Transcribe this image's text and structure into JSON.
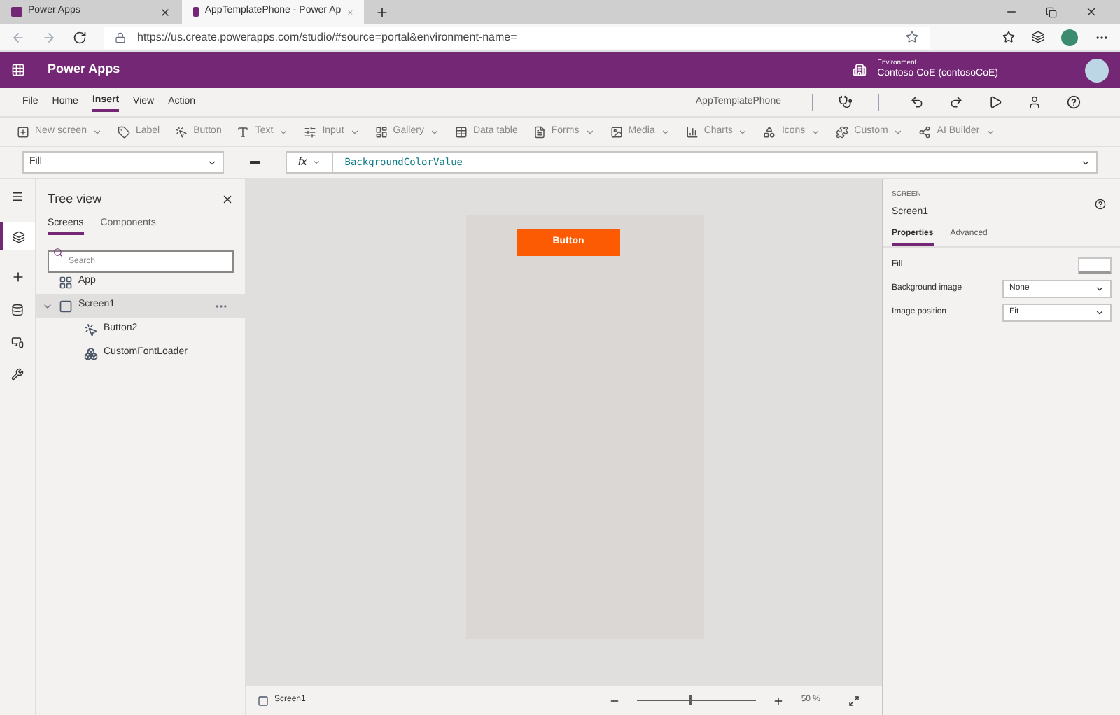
{
  "browser": {
    "tabs": [
      {
        "title": "Power Apps",
        "selected": false
      },
      {
        "title": "AppTemplatePhone - Power Ap",
        "selected": true
      }
    ],
    "url": "https://us.create.powerapps.com/studio/#source=portal&environment-name="
  },
  "header": {
    "title": "Power Apps",
    "environment_label": "Environment",
    "environment_name": "Contoso CoE (contosoCoE)"
  },
  "menu": [
    {
      "label": "File",
      "selected": false
    },
    {
      "label": "Home",
      "selected": false
    },
    {
      "label": "Insert",
      "selected": true
    },
    {
      "label": "View",
      "selected": false
    },
    {
      "label": "Action",
      "selected": false
    }
  ],
  "app_name": "AppTemplatePhone",
  "ribbon": [
    {
      "label": "New screen",
      "dropdown": true
    },
    {
      "label": "Label",
      "dropdown": false
    },
    {
      "label": "Button",
      "dropdown": false
    },
    {
      "label": "Text",
      "dropdown": true
    },
    {
      "label": "Input",
      "dropdown": true
    },
    {
      "label": "Gallery",
      "dropdown": true
    },
    {
      "label": "Data table",
      "dropdown": false
    },
    {
      "label": "Forms",
      "dropdown": true
    },
    {
      "label": "Media",
      "dropdown": true
    },
    {
      "label": "Charts",
      "dropdown": true
    },
    {
      "label": "Icons",
      "dropdown": true
    },
    {
      "label": "Custom",
      "dropdown": true
    },
    {
      "label": "AI Builder",
      "dropdown": true
    }
  ],
  "formula": {
    "property": "Fill",
    "fx": "fx",
    "expression": "BackgroundColorValue"
  },
  "tree": {
    "title": "Tree view",
    "tabs": [
      {
        "label": "Screens",
        "selected": true
      },
      {
        "label": "Components",
        "selected": false
      }
    ],
    "search": {
      "placeholder": "Search"
    },
    "items": [
      {
        "kind": "app",
        "label": "App",
        "selected": false
      },
      {
        "kind": "screen",
        "label": "Screen1",
        "selected": true,
        "expanded": true,
        "children": [
          {
            "kind": "button",
            "label": "Button2",
            "selected": false
          },
          {
            "kind": "component",
            "label": "CustomFontLoader",
            "selected": false
          }
        ]
      }
    ]
  },
  "canvas": {
    "button_label": "Button"
  },
  "properties": {
    "type": "SCREEN",
    "name": "Screen1",
    "tabs": [
      {
        "label": "Properties",
        "selected": true
      },
      {
        "label": "Advanced",
        "selected": false
      }
    ],
    "rows": [
      {
        "kind": "color",
        "label": "Fill"
      },
      {
        "kind": "select",
        "label": "Background image",
        "value": "None"
      },
      {
        "kind": "select",
        "label": "Image position",
        "value": "Fit"
      }
    ]
  },
  "status_bar": {
    "screen": "Screen1",
    "zoom": {
      "level": 0.43,
      "reading": "50 %"
    }
  }
}
